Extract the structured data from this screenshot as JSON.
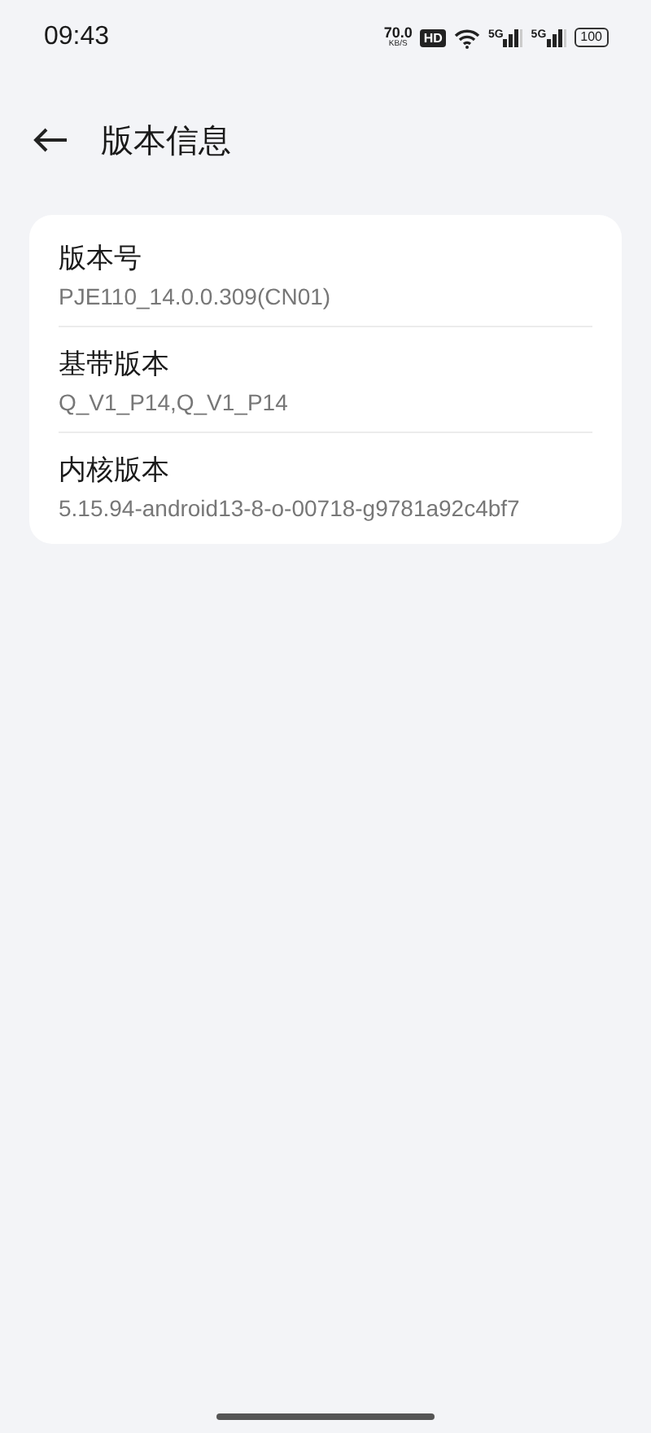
{
  "status_bar": {
    "time": "09:43",
    "speed": "70.0",
    "speed_unit": "KB/S",
    "hd": "HD",
    "signals": [
      "5G",
      "5G"
    ],
    "battery": "100"
  },
  "header": {
    "title": "版本信息"
  },
  "items": [
    {
      "title": "版本号",
      "value": "PJE110_14.0.0.309(CN01)"
    },
    {
      "title": "基带版本",
      "value": "Q_V1_P14,Q_V1_P14"
    },
    {
      "title": "内核版本",
      "value": "5.15.94-android13-8-o-00718-g9781a92c4bf7"
    }
  ]
}
